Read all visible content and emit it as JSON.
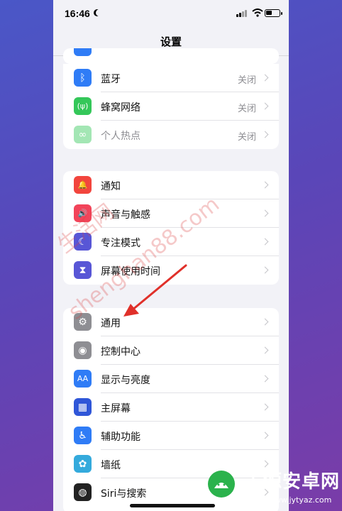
{
  "status": {
    "time": "16:46"
  },
  "nav": {
    "title": "设置"
  },
  "group1": [
    {
      "name": "bluetooth",
      "label": "蓝牙",
      "value": "关闭",
      "color": "#2f7cf6",
      "icon": "bluetooth-icon",
      "glyph": "ᛒ"
    },
    {
      "name": "cellular",
      "label": "蜂窝网络",
      "value": "关闭",
      "color": "#34c759",
      "icon": "antenna-icon",
      "glyph": "(ψ)"
    },
    {
      "name": "hotspot",
      "label": "个人热点",
      "value": "关闭",
      "color": "#34c759",
      "icon": "hotspot-icon",
      "glyph": "∞",
      "dim": true
    }
  ],
  "group2": [
    {
      "name": "notifications",
      "label": "通知",
      "color": "#f2453d",
      "icon": "bell-icon",
      "glyph": "🔔"
    },
    {
      "name": "sounds",
      "label": "声音与触感",
      "color": "#f2445a",
      "icon": "speaker-icon",
      "glyph": "🔊"
    },
    {
      "name": "focus",
      "label": "专注模式",
      "color": "#5856d6",
      "icon": "moon-icon",
      "glyph": "☾"
    },
    {
      "name": "screen-time",
      "label": "屏幕使用时间",
      "color": "#5856d6",
      "icon": "hourglass-icon",
      "glyph": "⧗"
    }
  ],
  "group3": [
    {
      "name": "general",
      "label": "通用",
      "color": "#8e8e93",
      "icon": "gear-icon",
      "glyph": "⚙"
    },
    {
      "name": "control-center",
      "label": "控制中心",
      "color": "#8e8e93",
      "icon": "toggles-icon",
      "glyph": "◉"
    },
    {
      "name": "display",
      "label": "显示与亮度",
      "color": "#2f7cf6",
      "icon": "text-size-icon",
      "glyph": "AA"
    },
    {
      "name": "home-screen",
      "label": "主屏幕",
      "color": "#2f56d8",
      "icon": "grid-icon",
      "glyph": "▦"
    },
    {
      "name": "accessibility",
      "label": "辅助功能",
      "color": "#2f7cf6",
      "icon": "accessibility-icon",
      "glyph": "♿"
    },
    {
      "name": "wallpaper",
      "label": "墙纸",
      "color": "#34aadc",
      "icon": "flower-icon",
      "glyph": "✿"
    },
    {
      "name": "siri",
      "label": "Siri与搜索",
      "color": "#222222",
      "icon": "siri-icon",
      "glyph": "◍"
    }
  ],
  "watermark": {
    "line1": "生活网",
    "line2": "shenghan88.com"
  },
  "logo": {
    "name": "天源安卓网",
    "url": "www.jytyaz.com"
  }
}
